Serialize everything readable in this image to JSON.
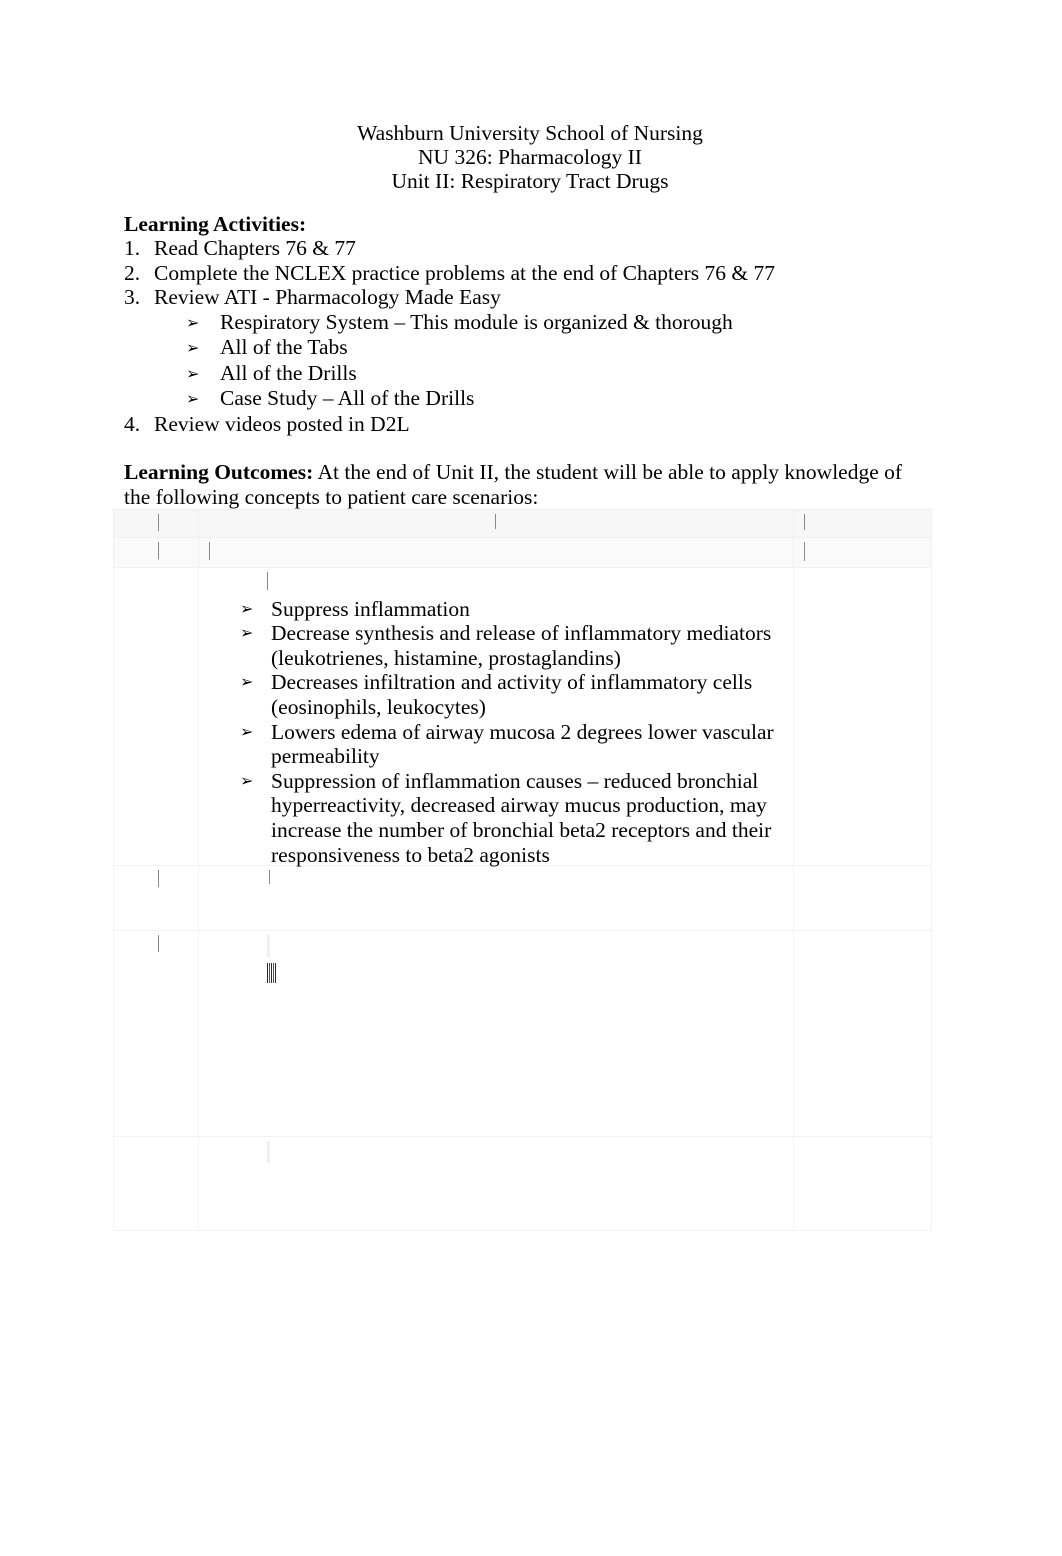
{
  "document": {
    "header": {
      "line1": "Washburn University School of Nursing",
      "line2": "NU 326: Pharmacology II",
      "line3": "Unit II: Respiratory Tract Drugs"
    },
    "learning_activities": {
      "heading": "Learning Activities:",
      "items": [
        {
          "number": "1.",
          "text": "Read Chapters 76 & 77"
        },
        {
          "number": "2.",
          "text": "Complete the NCLEX practice problems at the end of Chapters 76 & 77"
        },
        {
          "number": "3.",
          "text": "Review ATI - Pharmacology Made Easy"
        },
        {
          "number": "4.",
          "text": "Review videos posted in D2L"
        }
      ],
      "sub_items": [
        "Respiratory System – This module is organized & thorough",
        "All of the Tabs",
        "All of the Drills",
        "Case Study – All of the Drills"
      ],
      "bullet_glyph": "➢"
    },
    "learning_outcomes": {
      "lead": "Learning Outcomes:",
      "text": " At the end of Unit II, the student will be able to apply knowledge of the following concepts to patient care scenarios:"
    },
    "table": {
      "bullet_glyph": "➢",
      "header_row_1": {
        "col_a": "",
        "col_b": "",
        "col_c": ""
      },
      "header_row_2": {
        "col_a": "",
        "col_b": "",
        "col_c": ""
      },
      "content_cell_bullets": [
        "Suppress inflammation",
        "Decrease synthesis and release of inflammatory mediators (leukotrienes, histamine, prostaglandins)",
        "Decreases infiltration and activity of inflammatory cells (eosinophils, leukocytes)",
        "Lowers edema of airway mucosa 2 degrees lower vascular permeability",
        "Suppression of inflammation causes – reduced bronchial hyperreactivity, decreased airway mucus production, may increase the number of bronchial beta2 receptors and their responsiveness to beta2 agonists"
      ],
      "blank_rows": [
        {
          "col_a": "",
          "col_b": "",
          "col_c": ""
        },
        {
          "col_a": "",
          "col_b": "",
          "col_c": ""
        },
        {
          "col_a": "",
          "col_b": "",
          "col_c": ""
        }
      ]
    },
    "colors": {
      "page_background": "#ffffff",
      "text": "#000000",
      "table_border": "#f2f2f2",
      "header_row_fill": "#f7f7f7"
    }
  }
}
